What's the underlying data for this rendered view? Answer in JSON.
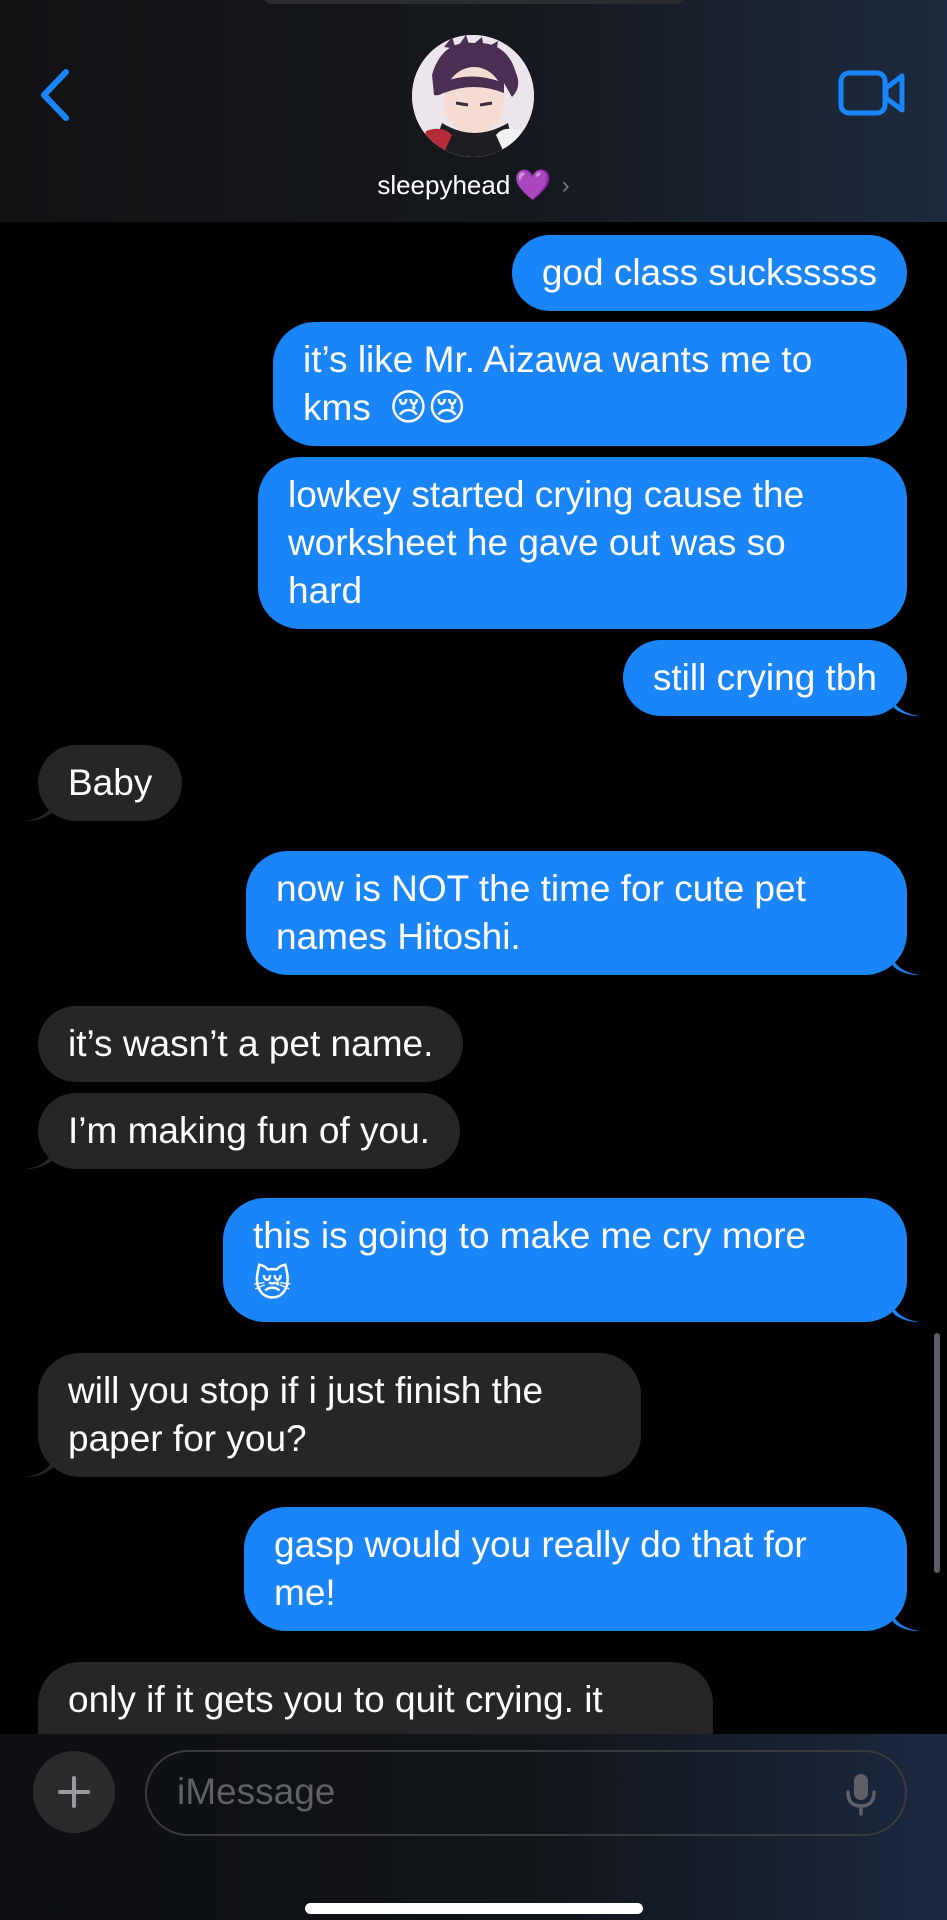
{
  "header": {
    "contact_name": "sleepyhead",
    "contact_emoji": "💜",
    "back_icon": "chevron-left-icon",
    "video_icon": "video-camera-icon",
    "accent_color": "#1985f8"
  },
  "messages": [
    {
      "from": "me",
      "text": "god class sucksssss"
    },
    {
      "from": "me",
      "line1": "it’s like Mr. Aizawa wants me to",
      "line2": "kms",
      "emoji": "😢😢"
    },
    {
      "from": "me",
      "line1": "lowkey started crying cause the",
      "line2": "worksheet he gave out was so",
      "line3": "hard"
    },
    {
      "from": "me",
      "text": "still crying tbh"
    },
    {
      "from": "them",
      "text": "Baby"
    },
    {
      "from": "me",
      "line1": "now is NOT the time for cute pet",
      "line2": "names Hitoshi."
    },
    {
      "from": "them",
      "text": "it’s wasn’t a pet name."
    },
    {
      "from": "them",
      "text": "I’m making fun of you."
    },
    {
      "from": "me",
      "line1": "this is going to make me cry more",
      "emoji": "😿"
    },
    {
      "from": "them",
      "line1": "will you stop if i just finish the",
      "line2": "paper for you?"
    },
    {
      "from": "me",
      "line1": "gasp would you really do that for",
      "line2": "me!"
    },
    {
      "from": "them",
      "line1": "only if it gets you to quit crying. it"
    }
  ],
  "input": {
    "placeholder": "iMessage",
    "plus_icon": "plus-icon",
    "mic_icon": "microphone-icon"
  },
  "colors": {
    "sent_bubble": "#1985f8",
    "received_bubble": "#262628",
    "background": "#000000"
  }
}
